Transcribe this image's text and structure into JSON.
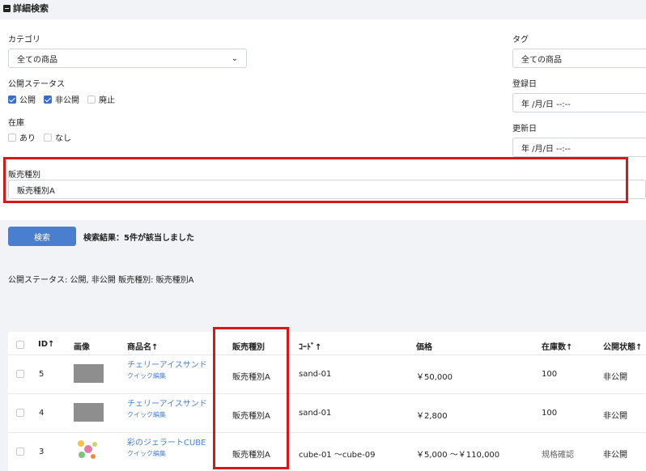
{
  "advanced_search": {
    "title": "詳細検索"
  },
  "category": {
    "label": "カテゴリ",
    "value": "全ての商品"
  },
  "tag": {
    "label": "タグ",
    "value": "全ての商品"
  },
  "status": {
    "label": "公開ステータス",
    "options": [
      {
        "label": "公開",
        "checked": true
      },
      {
        "label": "非公開",
        "checked": true
      },
      {
        "label": "廃止",
        "checked": false
      }
    ]
  },
  "registered": {
    "label": "登録日",
    "value": "年 /月/日 --:--"
  },
  "stock": {
    "label": "在庫",
    "options": [
      {
        "label": "あり",
        "checked": false
      },
      {
        "label": "なし",
        "checked": false
      }
    ]
  },
  "updated": {
    "label": "更新日",
    "value": "年 /月/日 --:--"
  },
  "sales_type": {
    "label": "販売種別",
    "value": "販売種別A"
  },
  "search_button": "検索",
  "result_text": "検索結果：5件が該当しました",
  "conditions": "公開ステータス: 公開, 非公開   販売種別: 販売種別A",
  "table": {
    "headers": {
      "id": "ID↑",
      "image": "画像",
      "name": "商品名↑",
      "sales_type": "販売種別",
      "code": "ｺｰﾄﾞ↑",
      "price": "価格",
      "stock": "在庫数↑",
      "status": "公開状態↑"
    },
    "quick_edit": "クイック編集",
    "rows": [
      {
        "id": "5",
        "name": "チェリーアイスサンド",
        "sales_type": "販売種別A",
        "code": "sand-01",
        "price": "￥50,000",
        "stock": "100",
        "status": "非公開"
      },
      {
        "id": "4",
        "name": "チェリーアイスサンド",
        "sales_type": "販売種別A",
        "code": "sand-01",
        "price": "￥2,800",
        "stock": "100",
        "status": "非公開"
      },
      {
        "id": "3",
        "name": "彩のジェラートCUBE",
        "sales_type": "販売種別A",
        "code": "cube-01 ～cube-09",
        "price": "￥5,000 ～￥110,000",
        "stock": "規格確認",
        "status": "非公開"
      }
    ]
  },
  "colors": {
    "accent": "#4a7fd0",
    "highlight": "#d81818"
  }
}
